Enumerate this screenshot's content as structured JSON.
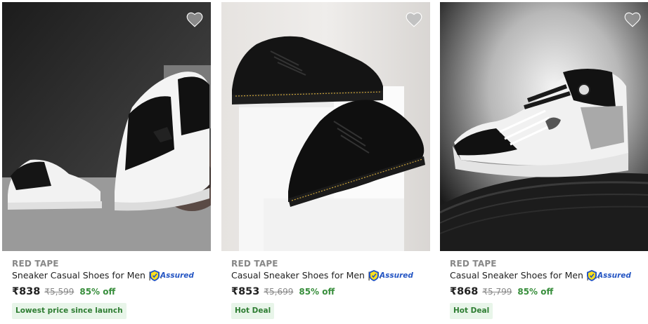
{
  "products": [
    {
      "brand": "RED TAPE",
      "title": "Sneaker Casual Shoes for Men | ...",
      "assured": "Assured",
      "price": "₹838",
      "mrp": "₹5,599",
      "discount": "85% off",
      "badge": "Lowest price since launch",
      "wishlist_icon": "heart-icon"
    },
    {
      "brand": "RED TAPE",
      "title": "Casual Sneaker Shoes for Men | ...",
      "assured": "Assured",
      "price": "₹853",
      "mrp": "₹5,699",
      "discount": "85% off",
      "badge": "Hot Deal",
      "wishlist_icon": "heart-icon"
    },
    {
      "brand": "RED TAPE",
      "title": "Casual Sneaker Shoes for Men | ...",
      "assured": "Assured",
      "price": "₹868",
      "mrp": "₹5,799",
      "discount": "85% off",
      "badge": "Hot Deal",
      "wishlist_icon": "heart-icon"
    }
  ],
  "colors": {
    "brand_gray": "#878787",
    "discount_green": "#388e3c",
    "badge_bg": "#e8f5e9",
    "assured_blue": "#2455c3"
  }
}
